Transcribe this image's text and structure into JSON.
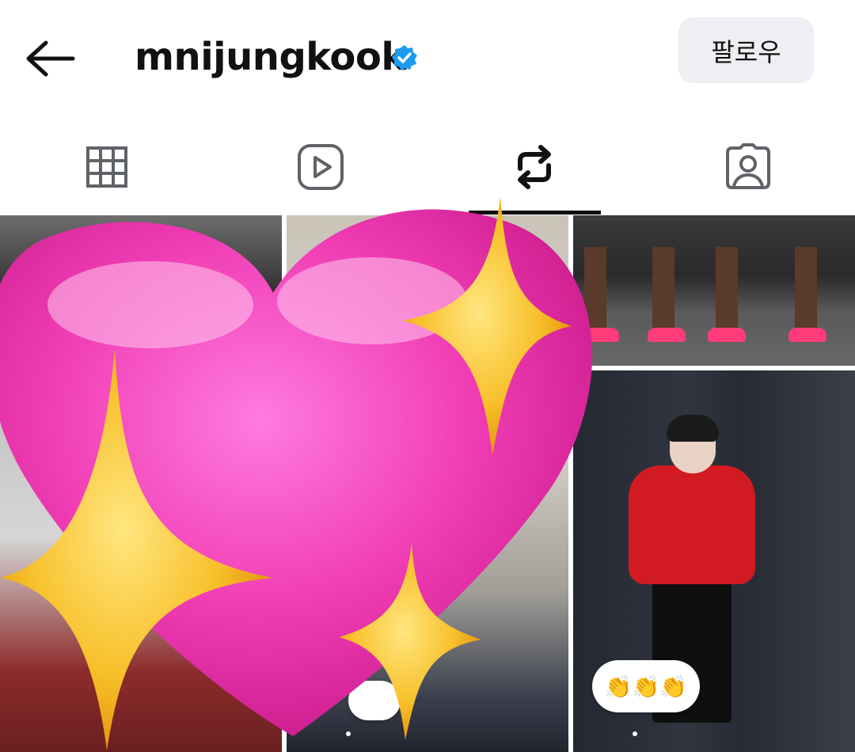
{
  "header": {
    "back_icon": "arrow-left-icon",
    "username": "mnijungkook",
    "verified_icon": "verified-badge-icon",
    "verified_color": "#1d9bf0",
    "follow_label": "팔로우"
  },
  "tabs": [
    {
      "icon": "grid-icon",
      "active": false
    },
    {
      "icon": "reels-icon",
      "active": false
    },
    {
      "icon": "reposts-icon",
      "active": true
    },
    {
      "icon": "tagged-icon",
      "active": false
    }
  ],
  "grid": {
    "tiles": [
      {
        "icon": "photo-tile"
      },
      {
        "icon": "photo-tile"
      },
      {
        "icon": "photo-tile"
      },
      {
        "icon": "photo-tile"
      }
    ],
    "reaction_emoji": "👏👏👏"
  },
  "overlay": {
    "icon": "sparkling-heart-emoji",
    "heart_color": "#f03cb4",
    "sparkle_color": "#f7c02a"
  }
}
